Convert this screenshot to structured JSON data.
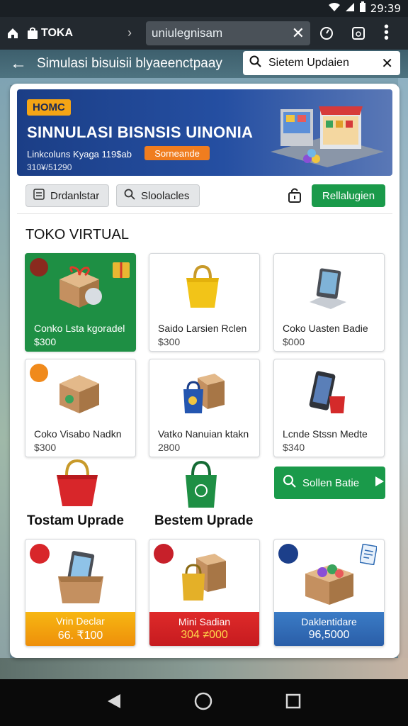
{
  "status_bar": {
    "time": "29:39"
  },
  "browser": {
    "tab_title": "TOKA",
    "url": "uniulegnisam"
  },
  "app_bar": {
    "title": "Simulasi bisuisii blyaeenctpaay",
    "search_text": "Sietem Updaien"
  },
  "banner": {
    "badge": "HOMC",
    "title": "SINNULASI BISNSIS UINONIA",
    "subtitle": "Linkcoluns Kyaga 119$ab",
    "code": "310¥/51290",
    "button": "Sorneande"
  },
  "toolbar": {
    "btn1": "Drdanlstar",
    "btn2": "Sloolacles",
    "green_btn": "Rellalugien"
  },
  "section_title": "TOKO VIRTUAL",
  "tiles": [
    {
      "name": "Conko Lsta kgoradel",
      "price": "$300"
    },
    {
      "name": "Saido Larsien Rclen",
      "price": "$300"
    },
    {
      "name": "Coko Uasten Badie",
      "price": "$000"
    },
    {
      "name": "Coko Visabo Nadkn",
      "price": "$300"
    },
    {
      "name": "Vatko Nanuian ktakn",
      "price": "2800"
    },
    {
      "name": "Lcnde Stssn Medte",
      "price": "$340"
    }
  ],
  "upgrades": {
    "left": "Tostam Uprade",
    "middle": "Bestem Uprade",
    "solve_btn": "Sollen Batie"
  },
  "promos": [
    {
      "name": "Vrin Declar",
      "value": "66. ₹100"
    },
    {
      "name": "Mini Sadian",
      "value": "304 ≠000"
    },
    {
      "name": "Daklentidare",
      "value": "96,5000"
    }
  ],
  "colors": {
    "accent_green": "#1a9a4a",
    "banner_blue": "#1b3e86",
    "orange": "#f07d1f",
    "promo_yellow": "#f6a800",
    "promo_red": "#d21f26",
    "promo_blue": "#2f6bb3"
  }
}
